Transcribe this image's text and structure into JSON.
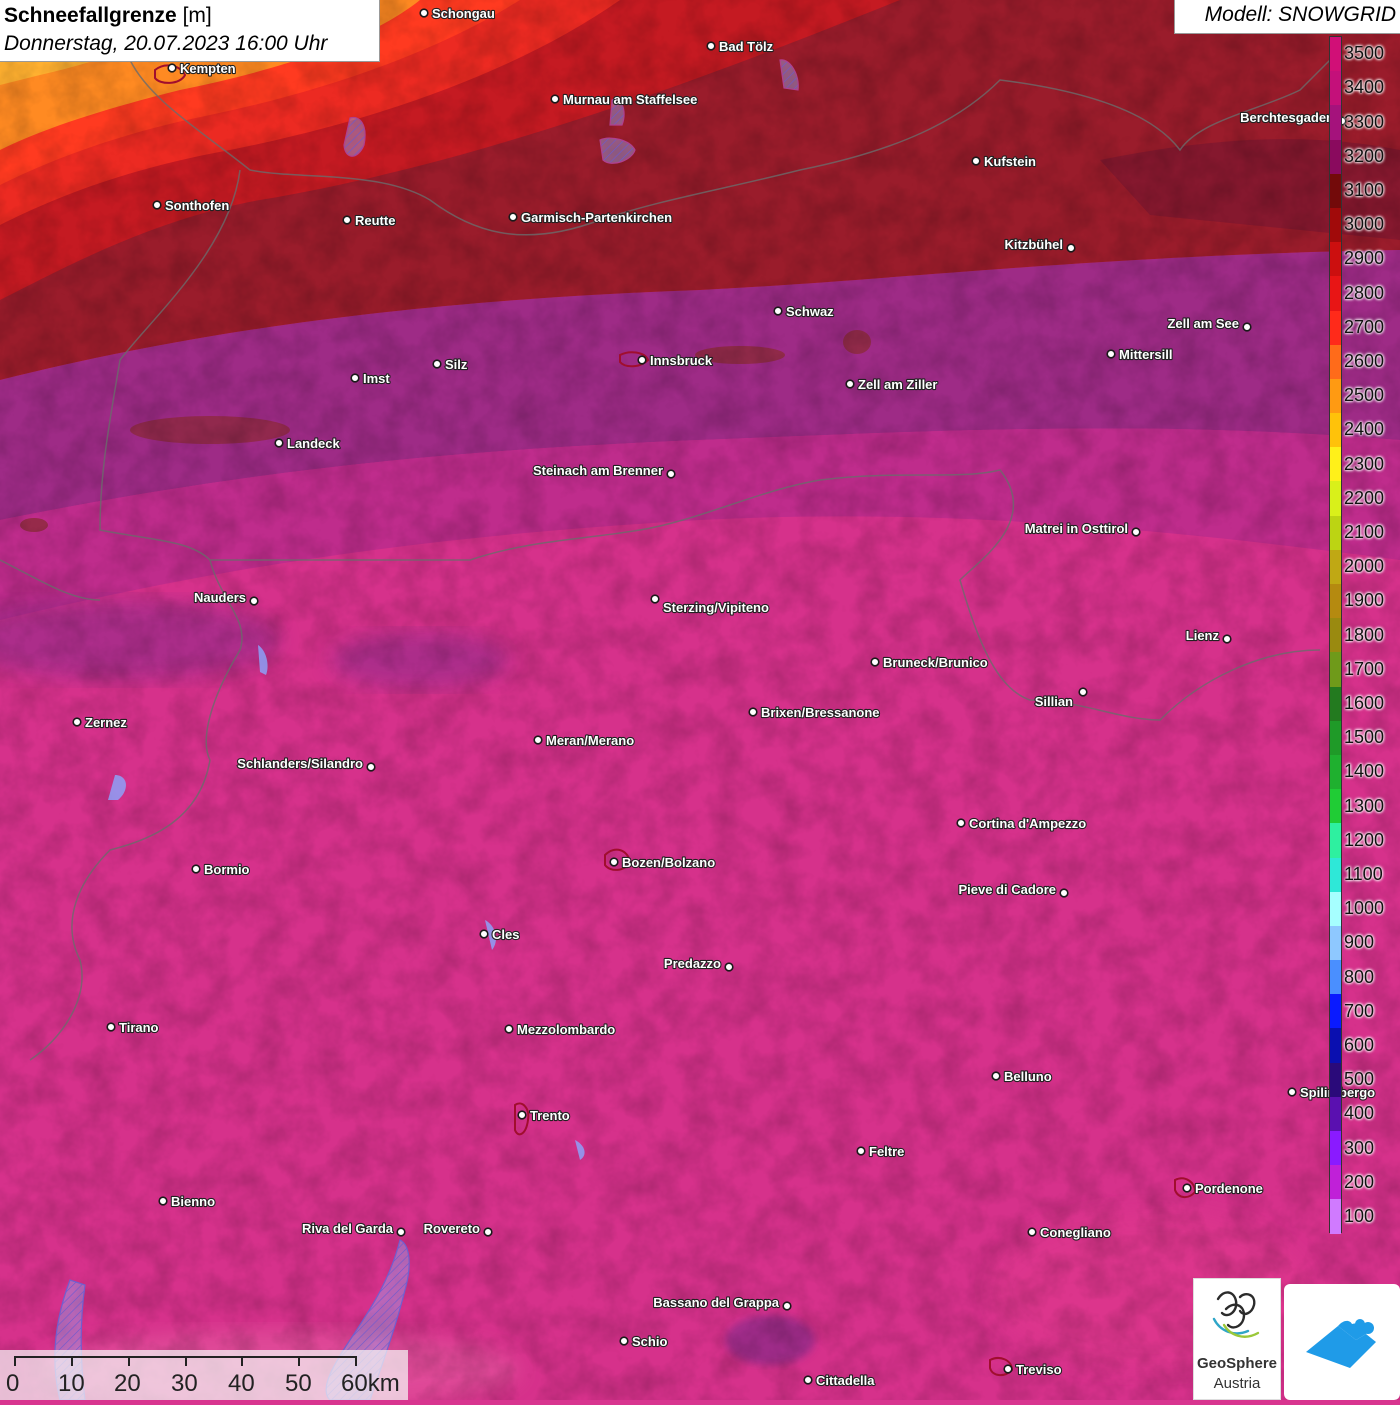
{
  "title": {
    "main": "Schneefallgrenze",
    "unit": "[m]",
    "datetime": "Donnerstag, 20.07.2023 16:00 Uhr"
  },
  "model": "Modell: SNOWGRID",
  "legend": {
    "labels": [
      "3500",
      "3400",
      "3300",
      "3200",
      "3100",
      "3000",
      "2900",
      "2800",
      "2700",
      "2600",
      "2500",
      "2400",
      "2300",
      "2200",
      "2100",
      "2000",
      "1900",
      "1800",
      "1700",
      "1600",
      "1500",
      "1400",
      "1300",
      "1200",
      "1100",
      "1000",
      "900",
      "800",
      "700",
      "600",
      "500",
      "400",
      "300",
      "200",
      "100"
    ],
    "colors": [
      "#d10f77",
      "#c4107a",
      "#a5127c",
      "#8a0a5e",
      "#730a0a",
      "#a10a0a",
      "#cc0f0f",
      "#e81515",
      "#ff2a1a",
      "#ff6b1a",
      "#ff9a12",
      "#ffc20a",
      "#fff01a",
      "#d9f01a",
      "#bcd413",
      "#c0a814",
      "#b58a10",
      "#9a8a10",
      "#6f9a1a",
      "#237a1f",
      "#1f9a28",
      "#1fb02f",
      "#20cc35",
      "#2ef0a0",
      "#2ee8d8",
      "#a6ffff",
      "#8ec8ff",
      "#4a8fff",
      "#0a1aff",
      "#0a0fb0",
      "#2a0a7a",
      "#5a10b0",
      "#8a1aff",
      "#c020d8",
      "#d07aff"
    ]
  },
  "scalebar": {
    "labels": [
      "0",
      "10",
      "20",
      "30",
      "40",
      "50",
      "60km"
    ]
  },
  "logos": {
    "geosphere_name": "GeoSphere",
    "geosphere_country": "Austria"
  },
  "cities": [
    {
      "name": "Schongau"
    },
    {
      "name": "Bad Tölz"
    },
    {
      "name": "Kempten"
    },
    {
      "name": "Murnau am Staffelsee"
    },
    {
      "name": "Kufstein"
    },
    {
      "name": "Berchtesgaden"
    },
    {
      "name": "Sonthofen"
    },
    {
      "name": "Reutte"
    },
    {
      "name": "Garmisch-Partenkirchen"
    },
    {
      "name": "Kitzbühel"
    },
    {
      "name": "Schwaz"
    },
    {
      "name": "Zell am See"
    },
    {
      "name": "Innsbruck"
    },
    {
      "name": "Mittersill"
    },
    {
      "name": "Imst"
    },
    {
      "name": "Silz"
    },
    {
      "name": "Zell am Ziller"
    },
    {
      "name": "Landeck"
    },
    {
      "name": "Steinach am Brenner"
    },
    {
      "name": "Matrei in Osttirol"
    },
    {
      "name": "Nauders"
    },
    {
      "name": "Sterzing/Vipiteno"
    },
    {
      "name": "Lienz"
    },
    {
      "name": "Bruneck/Brunico"
    },
    {
      "name": "Sillian"
    },
    {
      "name": "Zernez"
    },
    {
      "name": "Brixen/Bressanone"
    },
    {
      "name": "Meran/Merano"
    },
    {
      "name": "Schlanders/Silandro"
    },
    {
      "name": "Cortina d'Ampezzo"
    },
    {
      "name": "Bozen/Bolzano"
    },
    {
      "name": "Bormio"
    },
    {
      "name": "Pieve di Cadore"
    },
    {
      "name": "Cles"
    },
    {
      "name": "Predazzo"
    },
    {
      "name": "Tirano"
    },
    {
      "name": "Mezzolombardo"
    },
    {
      "name": "Belluno"
    },
    {
      "name": "Spilimbergo"
    },
    {
      "name": "Trento"
    },
    {
      "name": "Feltre"
    },
    {
      "name": "Pordenone"
    },
    {
      "name": "Bienno"
    },
    {
      "name": "Riva del Garda"
    },
    {
      "name": "Rovereto"
    },
    {
      "name": "Conegliano"
    },
    {
      "name": "Bassano del Grappa"
    },
    {
      "name": "Schio"
    },
    {
      "name": "Treviso"
    },
    {
      "name": "Cittadella"
    }
  ]
}
